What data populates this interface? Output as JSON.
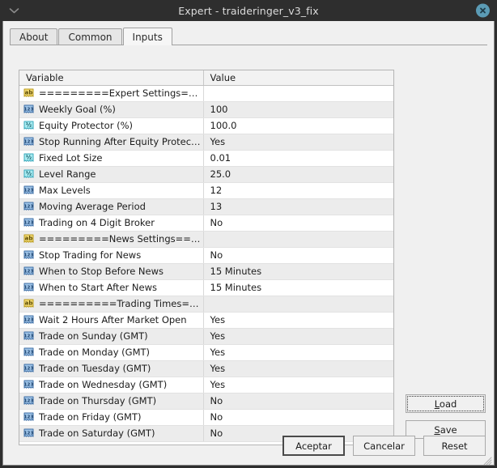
{
  "window": {
    "title": "Expert - traideringer_v3_fix",
    "menu_icon": "chevron-down-icon",
    "close_icon": "close-icon"
  },
  "tabs": [
    {
      "label": "About",
      "active": false
    },
    {
      "label": "Common",
      "active": false
    },
    {
      "label": "Inputs",
      "active": true
    }
  ],
  "table": {
    "columns": [
      "Variable",
      "Value"
    ],
    "rows": [
      {
        "icon": "string-type-icon",
        "variable": "=========Expert Settings======...",
        "value": ""
      },
      {
        "icon": "integer-type-icon",
        "variable": "Weekly Goal (%)",
        "value": "100"
      },
      {
        "icon": "double-type-icon",
        "variable": "Equity Protector (%)",
        "value": "100.0"
      },
      {
        "icon": "integer-type-icon",
        "variable": "Stop Running After Equity Protection",
        "value": "Yes"
      },
      {
        "icon": "double-type-icon",
        "variable": "Fixed Lot Size",
        "value": "0.01"
      },
      {
        "icon": "double-type-icon",
        "variable": "Level Range",
        "value": "25.0"
      },
      {
        "icon": "integer-type-icon",
        "variable": "Max Levels",
        "value": "12"
      },
      {
        "icon": "integer-type-icon",
        "variable": "Moving Average Period",
        "value": "13"
      },
      {
        "icon": "integer-type-icon",
        "variable": "Trading on 4 Digit Broker",
        "value": "No"
      },
      {
        "icon": "string-type-icon",
        "variable": "=========News Settings======...",
        "value": ""
      },
      {
        "icon": "integer-type-icon",
        "variable": "Stop Trading for News",
        "value": "No"
      },
      {
        "icon": "integer-type-icon",
        "variable": "When to Stop Before News",
        "value": "15 Minutes"
      },
      {
        "icon": "integer-type-icon",
        "variable": "When to Start After News",
        "value": "15 Minutes"
      },
      {
        "icon": "string-type-icon",
        "variable": "==========Trading Times=====...",
        "value": ""
      },
      {
        "icon": "integer-type-icon",
        "variable": "Wait 2 Hours After Market Open",
        "value": "Yes"
      },
      {
        "icon": "integer-type-icon",
        "variable": "Trade on Sunday (GMT)",
        "value": "Yes"
      },
      {
        "icon": "integer-type-icon",
        "variable": "Trade on Monday (GMT)",
        "value": "Yes"
      },
      {
        "icon": "integer-type-icon",
        "variable": "Trade on Tuesday (GMT)",
        "value": "Yes"
      },
      {
        "icon": "integer-type-icon",
        "variable": "Trade on Wednesday (GMT)",
        "value": "Yes"
      },
      {
        "icon": "integer-type-icon",
        "variable": "Trade on Thursday (GMT)",
        "value": "No"
      },
      {
        "icon": "integer-type-icon",
        "variable": "Trade on Friday (GMT)",
        "value": "No"
      },
      {
        "icon": "integer-type-icon",
        "variable": "Trade on Saturday (GMT)",
        "value": "No"
      }
    ]
  },
  "side_buttons": [
    {
      "label": "Load",
      "accel": "L",
      "focused": true
    },
    {
      "label": "Save",
      "accel": "S",
      "focused": false
    }
  ],
  "bottom_buttons": [
    {
      "label": "Aceptar",
      "default": true
    },
    {
      "label": "Cancelar",
      "default": false
    },
    {
      "label": "Reset",
      "default": false
    }
  ],
  "colors": {
    "titlebar": "#2e2e2e",
    "panel": "#f0f0f0",
    "close_button": "#5b9bb5",
    "row_alt": "#ececec",
    "string_icon": "#e8c84a",
    "integer_icon": "#4a86c8",
    "double_icon": "#5ecfe0"
  }
}
